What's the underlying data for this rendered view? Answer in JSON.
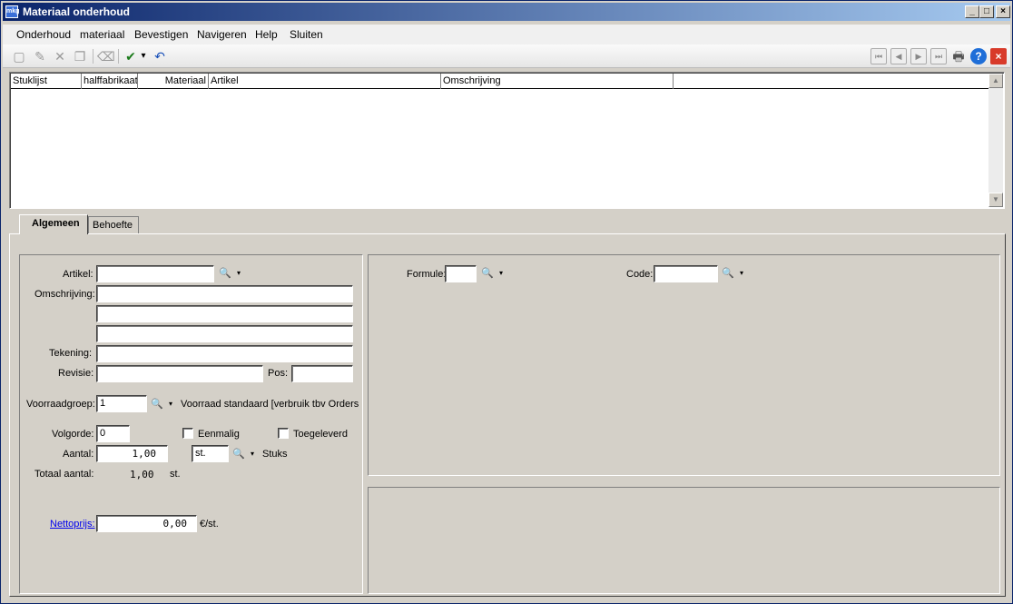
{
  "window": {
    "title": "Materiaal onderhoud",
    "icon": "app-logo-icon"
  },
  "window_buttons": {
    "minimize": "_",
    "maximize": "□",
    "close": "×"
  },
  "menu": [
    "Onderhoud",
    "materiaal",
    "Bevestigen",
    "Navigeren",
    "Help",
    "Sluiten"
  ],
  "toolbar": {
    "new": "▢",
    "edit": "✎",
    "delete": "✕",
    "copy": "❐",
    "erase": "⌫",
    "confirm": "✔",
    "confirm_dropdown": "▾",
    "undo": "↶",
    "first": "⏮",
    "prev": "◀",
    "next": "▶",
    "last": "⏭",
    "print": "🖶",
    "help": "?",
    "close": "×"
  },
  "grid": {
    "columns": [
      "Stuklijst",
      "halffabrikaat",
      "Materiaal",
      "Artikel",
      "Omschrijving",
      ""
    ],
    "rows": [],
    "scroll_up": "▲",
    "scroll_down": "▼"
  },
  "tabs": [
    "Algemeen",
    "Behoefte"
  ],
  "form": {
    "artikel_label": "Artikel:",
    "artikel_value": "",
    "omschrijving_label": "Omschrijving:",
    "omschrijving_1": "",
    "omschrijving_2": "",
    "omschrijving_3": "",
    "tekening_label": "Tekening:",
    "tekening_value": "",
    "revisie_label": "Revisie:",
    "revisie_value": "",
    "pos_label": "Pos:",
    "pos_value": "",
    "voorraadgroep_label": "Voorraadgroep:",
    "voorraadgroep_value": "1",
    "voorraadgroep_desc": "Voorraad standaard [verbruik tbv Orders",
    "volgorde_label": "Volgorde:",
    "volgorde_value": "0",
    "eenmalig_label": "Eenmalig",
    "toegeleverd_label": "Toegeleverd",
    "aantal_label": "Aantal:",
    "aantal_value": "1,00",
    "eenheid_value": "st.",
    "eenheid_desc": "Stuks",
    "totaal_label": "Totaal aantal:",
    "totaal_value": "1,00",
    "totaal_unit": "st.",
    "nettoprijs_label": "Nettoprijs:",
    "nettoprijs_value": "0,00",
    "nettoprijs_unit": "€/st.",
    "formule_label": "Formule:",
    "formule_value": "",
    "code_label": "Code:",
    "code_value": "",
    "lookup_glyph": "🔍",
    "dropdown_glyph": "▾"
  }
}
